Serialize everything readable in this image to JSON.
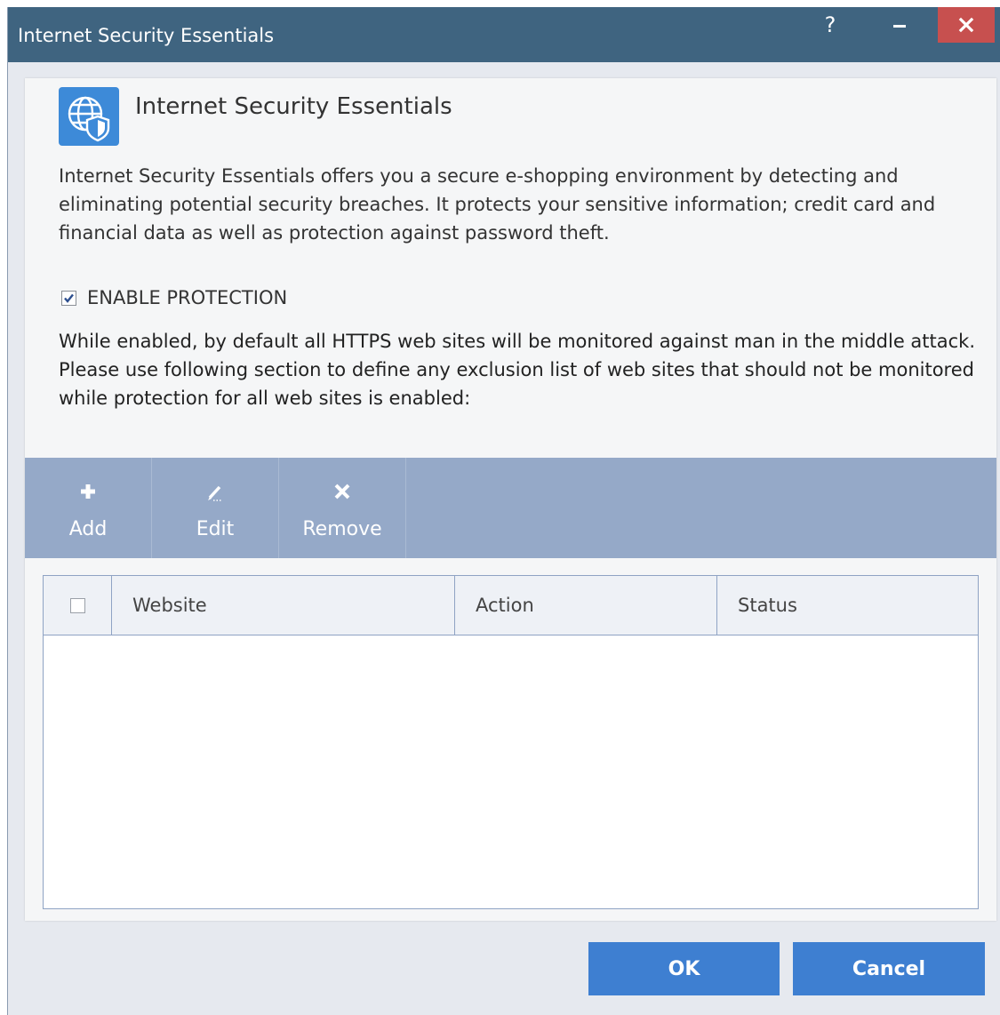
{
  "window": {
    "title": "Internet Security Essentials",
    "help_glyph": "?"
  },
  "header": {
    "icon": "globe-shield-icon",
    "title": "Internet Security Essentials"
  },
  "description": "Internet Security Essentials offers you a secure e-shopping environment by detecting and eliminating potential security breaches. It protects your sensitive information; credit card and financial data as well as protection against password theft.",
  "protection": {
    "label": "ENABLE PROTECTION",
    "checked": true
  },
  "notes": {
    "line1": "While enabled, by default all HTTPS web sites will be monitored against man in the middle attack.",
    "line2": "Please use following section to define any exclusion list of web sites that should not be monitored while protection for all web sites is enabled:"
  },
  "toolbar": {
    "add_label": "Add",
    "edit_label": "Edit",
    "remove_label": "Remove"
  },
  "table": {
    "columns": [
      "Website",
      "Action",
      "Status"
    ],
    "select_all_checked": false,
    "rows": []
  },
  "footer": {
    "ok_label": "OK",
    "cancel_label": "Cancel"
  },
  "colors": {
    "titlebar": "#3f6480",
    "close_button": "#c7504f",
    "toolbar": "#95a9c8",
    "primary_button": "#3e7fd1",
    "table_border": "#8fa3c4"
  }
}
